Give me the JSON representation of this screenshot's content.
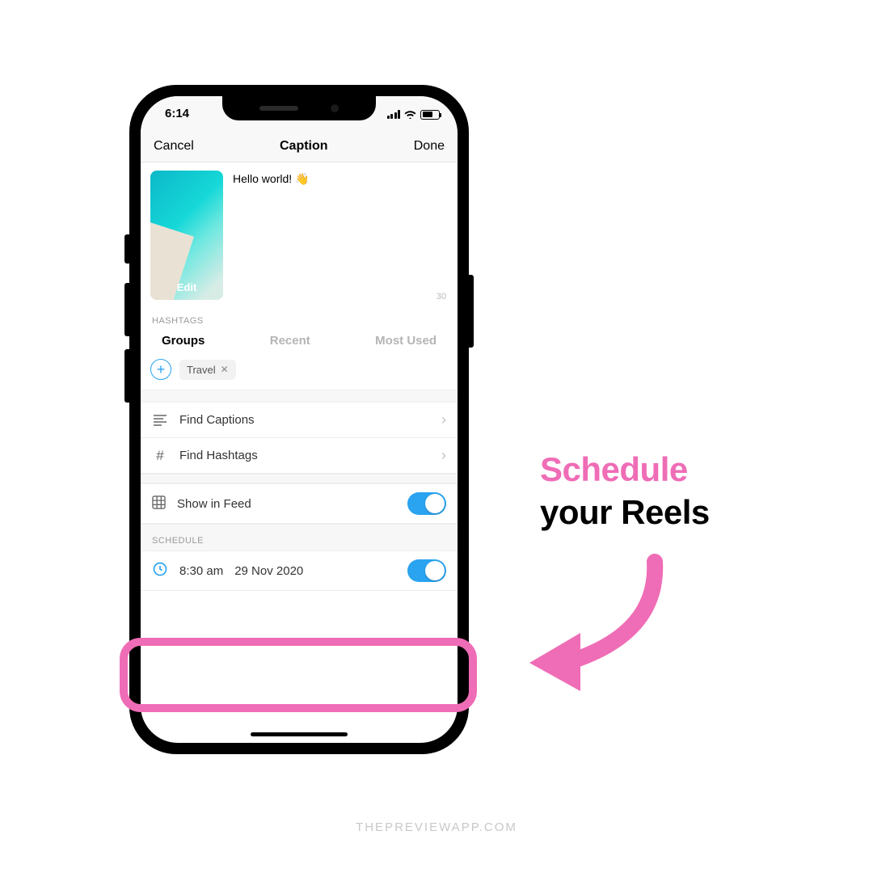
{
  "statusbar": {
    "time": "6:14"
  },
  "nav": {
    "left": "Cancel",
    "title": "Caption",
    "right": "Done"
  },
  "caption": {
    "text": "Hello world! 👋",
    "edit_label": "Edit",
    "char_count": "30"
  },
  "hashtags": {
    "section_label": "HASHTAGS",
    "tabs": {
      "groups": "Groups",
      "recent": "Recent",
      "most_used": "Most Used"
    },
    "pill": "Travel"
  },
  "rows": {
    "find_captions": "Find Captions",
    "find_hashtags": "Find Hashtags",
    "show_in_feed": "Show in Feed"
  },
  "schedule": {
    "section_label": "SCHEDULE",
    "time": "8:30 am",
    "date": "29 Nov 2020"
  },
  "annotation": {
    "line1": "Schedule",
    "line2": "your Reels"
  },
  "watermark": "THEPREVIEWAPP.COM",
  "colors": {
    "accent_blue": "#2aa3f0",
    "accent_pink": "#ef6db6"
  }
}
